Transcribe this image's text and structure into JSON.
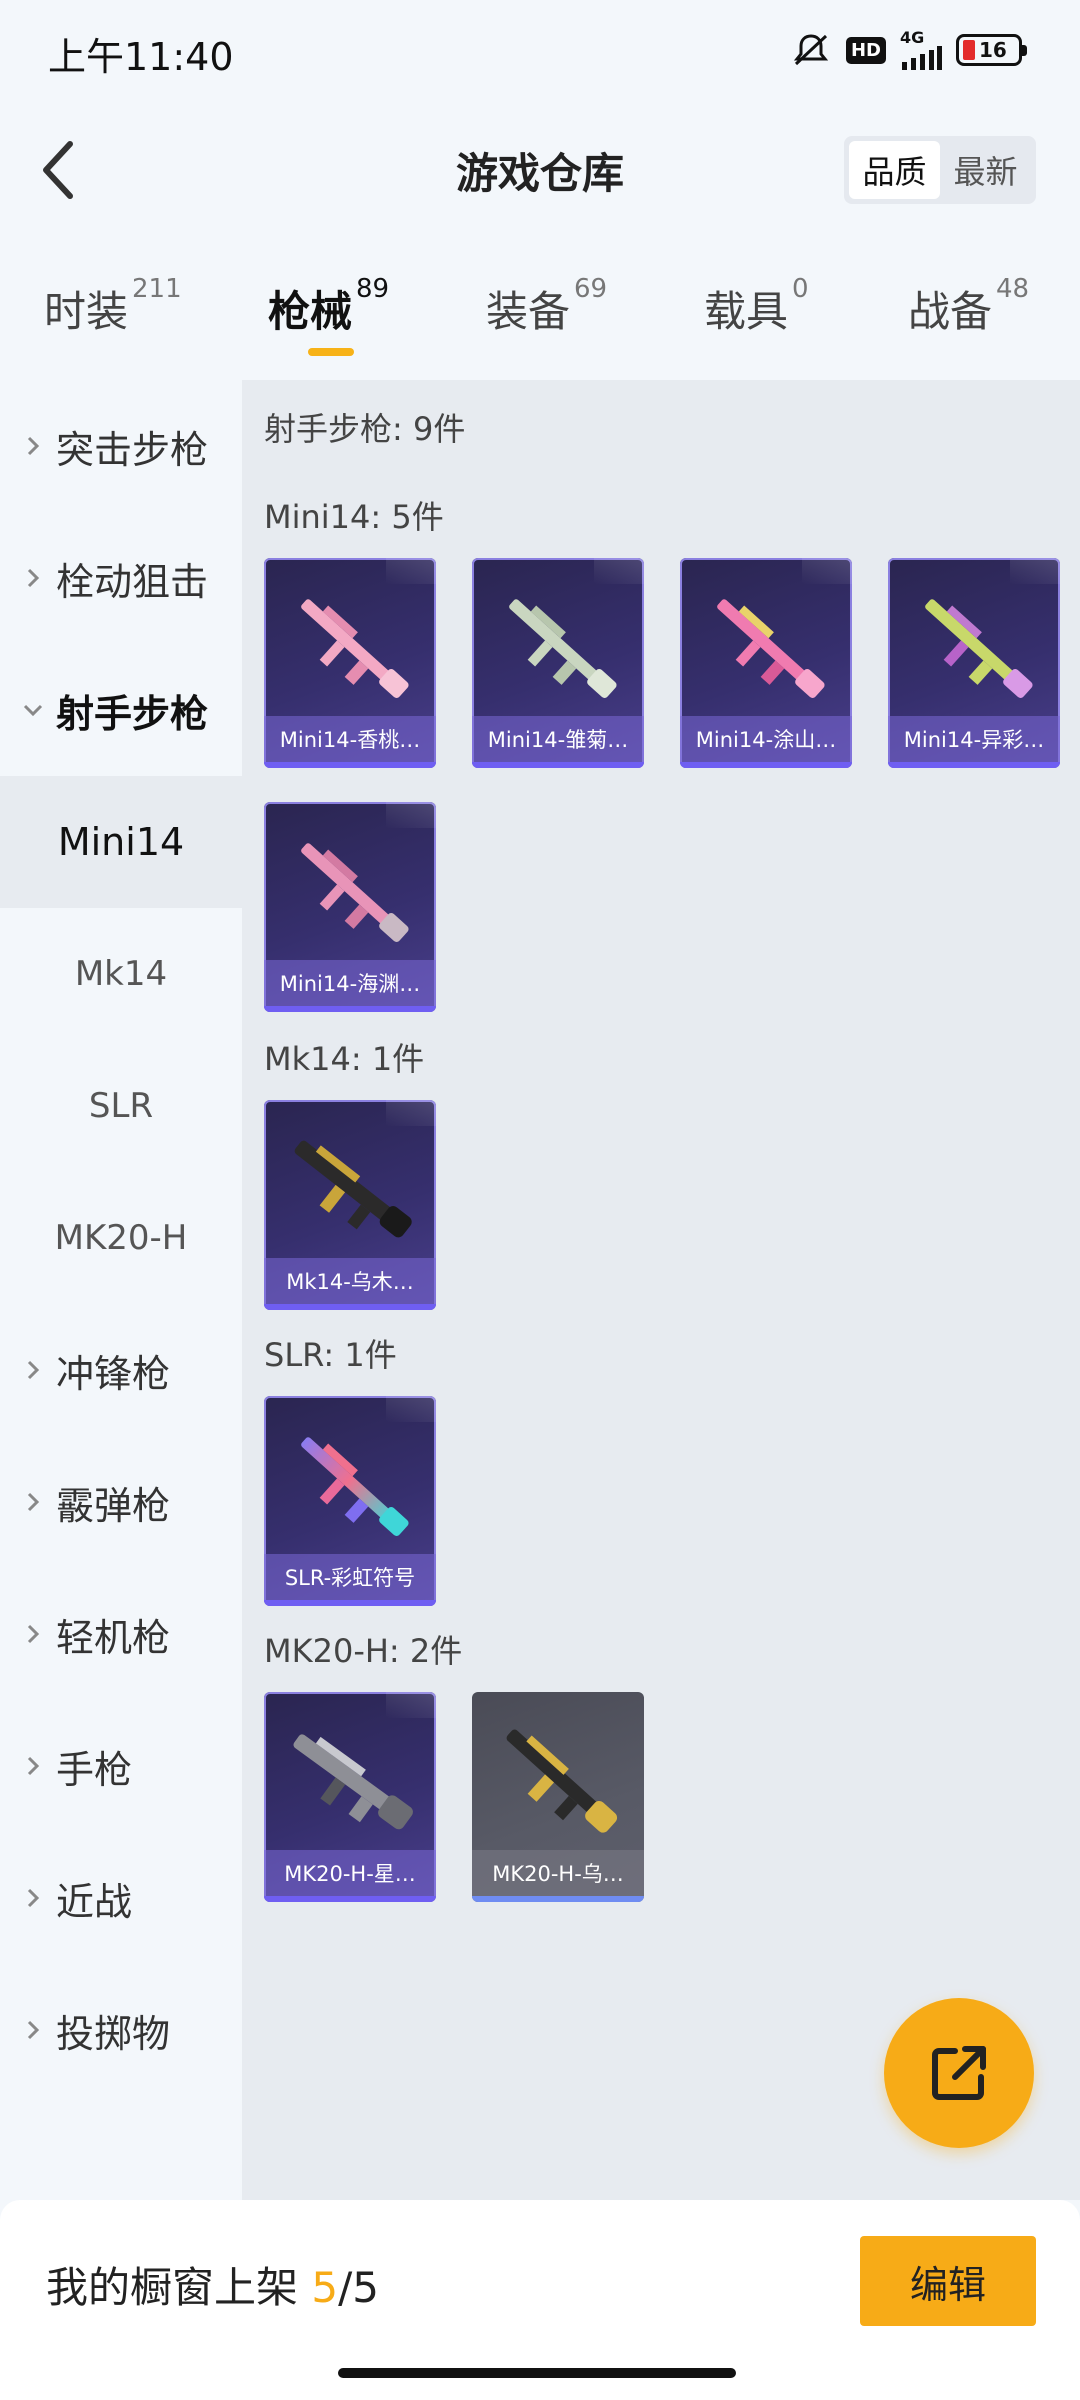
{
  "status_bar": {
    "time": "上午11:40",
    "hd": "HD",
    "network": "4G",
    "battery": "16"
  },
  "header": {
    "title": "游戏仓库",
    "sort_options": [
      "品质",
      "最新"
    ]
  },
  "tabs": [
    {
      "label": "时装",
      "count": "211"
    },
    {
      "label": "枪械",
      "count": "89"
    },
    {
      "label": "装备",
      "count": "69"
    },
    {
      "label": "载具",
      "count": "0"
    },
    {
      "label": "战备",
      "count": "48"
    }
  ],
  "sidebar": {
    "cat_assault": "突击步枪",
    "cat_bolt": "栓动狙击",
    "cat_marksman": "射手步枪",
    "sub_mini14": "Mini14",
    "sub_mk14": "Mk14",
    "sub_slr": "SLR",
    "sub_mk20h": "MK20-H",
    "cat_smg": "冲锋枪",
    "cat_shotgun": "霰弹枪",
    "cat_lmg": "轻机枪",
    "cat_pistol": "手枪",
    "cat_melee": "近战",
    "cat_throwable": "投掷物"
  },
  "content": {
    "category_total": "射手步枪: 9件",
    "mini14_head": "Mini14: 5件",
    "mk14_head": "Mk14: 1件",
    "slr_head": "SLR: 1件",
    "mk20h_head": "MK20-H: 2件",
    "mini14_items": [
      "Mini14-香桃…",
      "Mini14-雏菊…",
      "Mini14-涂山…",
      "Mini14-异彩…",
      "Mini14-海渊…"
    ],
    "mk14_items": [
      "Mk14-乌木…"
    ],
    "slr_items": [
      "SLR-彩虹符号"
    ],
    "mk20h_items": [
      "MK20-H-星…",
      "MK20-H-乌…"
    ]
  },
  "colors": {
    "accent": "#f7ab17",
    "card_purple": "#362f6e",
    "card_border": "#8b80e0"
  },
  "bottom": {
    "showcase_label": "我的橱窗上架 ",
    "showcase_count": "5",
    "showcase_total": "/5",
    "edit_label": "编辑"
  }
}
